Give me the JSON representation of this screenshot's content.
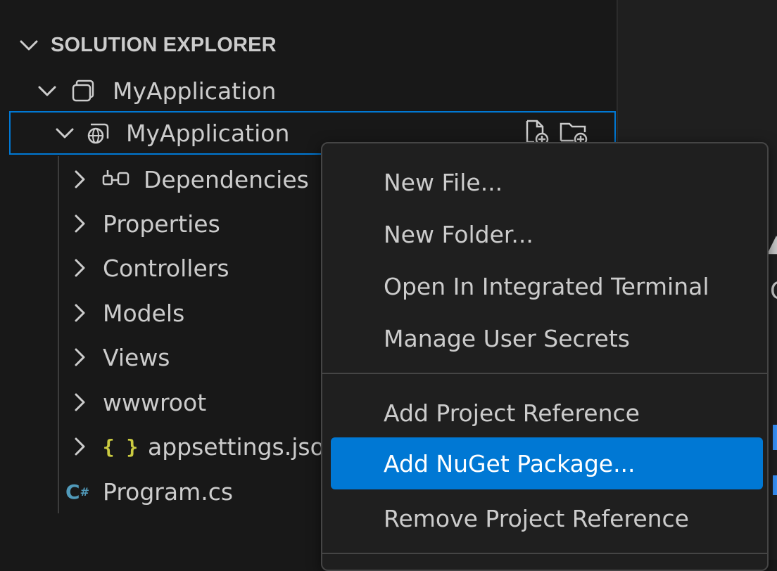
{
  "explorer": {
    "section_title": "SOLUTION EXPLORER",
    "solution": {
      "label": "MyApplication"
    },
    "project": {
      "label": "MyApplication"
    },
    "children": [
      {
        "label": "Dependencies",
        "icon": "dependencies-icon",
        "expandable": true
      },
      {
        "label": "Properties",
        "icon": null,
        "expandable": true
      },
      {
        "label": "Controllers",
        "icon": null,
        "expandable": true
      },
      {
        "label": "Models",
        "icon": null,
        "expandable": true
      },
      {
        "label": "Views",
        "icon": null,
        "expandable": true
      },
      {
        "label": "wwwroot",
        "icon": null,
        "expandable": true
      },
      {
        "label": "appsettings.json",
        "icon": "json-braces-icon",
        "expandable": true
      },
      {
        "label": "Program.cs",
        "icon": "csharp-file-icon",
        "expandable": false
      }
    ],
    "actions": [
      "new-file-icon",
      "new-folder-icon"
    ]
  },
  "context_menu": {
    "group1": [
      "New File...",
      "New Folder...",
      "Open In Integrated Terminal",
      "Manage User Secrets"
    ],
    "group2": [
      "Add Project Reference",
      "Add NuGet Package...",
      "Remove Project Reference"
    ],
    "active_item": "Add NuGet Package..."
  },
  "colors": {
    "background": "#181818",
    "selection_border": "#0078d4",
    "menu_active": "#0078d4",
    "json_icon": "#cbcb41",
    "csharp_icon": "#519aba"
  }
}
